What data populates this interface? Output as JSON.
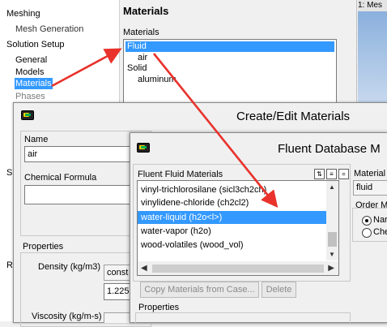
{
  "tree": {
    "meshing": "Meshing",
    "mesh_generation": "Mesh Generation",
    "solution_setup": "Solution Setup",
    "general": "General",
    "models": "Models",
    "materials": "Materials",
    "phases": "Phases",
    "partial_s": "S",
    "partial_r": "R"
  },
  "materials_panel": {
    "title": "Materials",
    "label": "Materials",
    "items": [
      "Fluid",
      "air",
      "Solid",
      "aluminum"
    ]
  },
  "right_tab": "1: Mes",
  "create_dialog": {
    "title": "Create/Edit Materials",
    "name_label": "Name",
    "name_value": "air",
    "formula_label": "Chemical Formula",
    "properties_label": "Properties",
    "density_label": "Density (kg/m3)",
    "density_method": "const",
    "density_value": "1.225",
    "viscosity_label": "Viscosity (kg/m-s)"
  },
  "db_dialog": {
    "title": "Fluent Database M",
    "list_label": "Fluent Fluid Materials",
    "items": [
      "vinyl-trichlorosilane (sicl3ch2ch)",
      "vinylidene-chloride (ch2cl2)",
      "water-liquid (h2o<l>)",
      "water-vapor (h2o)",
      "wood-volatiles (wood_vol)"
    ],
    "material_type_label": "Material",
    "material_type_value": "fluid",
    "order_label": "Order M",
    "order_opt1": "Nar",
    "order_opt2": "Che",
    "copy_button": "Copy Materials from Case...",
    "delete_button": "Delete",
    "properties_label": "Properties"
  }
}
